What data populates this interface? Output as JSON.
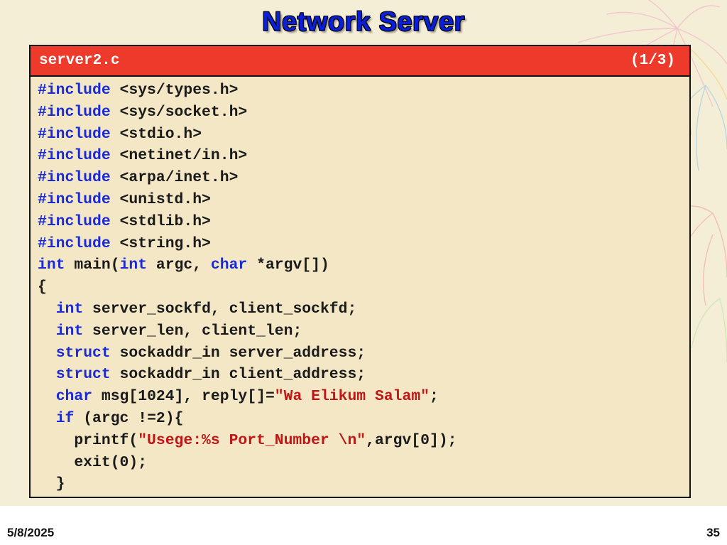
{
  "slide": {
    "title": "Network Server",
    "file_name": "server2.c",
    "page_indicator": "(1/3)",
    "footer_date": "5/8/2025",
    "footer_page": "35",
    "colors": {
      "title": "#0a1fd6",
      "header_bg": "#ee3a2a",
      "keyword": "#1a2ad6",
      "string": "#c01616",
      "background": "#f5eed6"
    }
  },
  "code_lines": [
    [
      {
        "t": "#include ",
        "c": "kw"
      },
      {
        "t": "<sys/types.h>",
        "c": ""
      }
    ],
    [
      {
        "t": "#include ",
        "c": "kw"
      },
      {
        "t": "<sys/socket.h>",
        "c": ""
      }
    ],
    [
      {
        "t": "#include ",
        "c": "kw"
      },
      {
        "t": "<stdio.h>",
        "c": ""
      }
    ],
    [
      {
        "t": "#include ",
        "c": "kw"
      },
      {
        "t": "<netinet/in.h>",
        "c": ""
      }
    ],
    [
      {
        "t": "#include ",
        "c": "kw"
      },
      {
        "t": "<arpa/inet.h>",
        "c": ""
      }
    ],
    [
      {
        "t": "#include ",
        "c": "kw"
      },
      {
        "t": "<unistd.h>",
        "c": ""
      }
    ],
    [
      {
        "t": "#include ",
        "c": "kw"
      },
      {
        "t": "<stdlib.h>",
        "c": ""
      }
    ],
    [
      {
        "t": "#include ",
        "c": "kw"
      },
      {
        "t": "<string.h>",
        "c": ""
      }
    ],
    [
      {
        "t": "int",
        "c": "kw"
      },
      {
        "t": " main(",
        "c": ""
      },
      {
        "t": "int",
        "c": "kw"
      },
      {
        "t": " argc, ",
        "c": ""
      },
      {
        "t": "char",
        "c": "kw"
      },
      {
        "t": " *argv[])",
        "c": ""
      }
    ],
    [
      {
        "t": "{",
        "c": ""
      }
    ],
    [
      {
        "t": "  ",
        "c": ""
      },
      {
        "t": "int",
        "c": "kw"
      },
      {
        "t": " server_sockfd, client_sockfd;",
        "c": ""
      }
    ],
    [
      {
        "t": "  ",
        "c": ""
      },
      {
        "t": "int",
        "c": "kw"
      },
      {
        "t": " server_len, client_len;",
        "c": ""
      }
    ],
    [
      {
        "t": "  ",
        "c": ""
      },
      {
        "t": "struct",
        "c": "kw"
      },
      {
        "t": " sockaddr_in server_address;",
        "c": ""
      }
    ],
    [
      {
        "t": "  ",
        "c": ""
      },
      {
        "t": "struct",
        "c": "kw"
      },
      {
        "t": " sockaddr_in client_address;",
        "c": ""
      }
    ],
    [
      {
        "t": "  ",
        "c": ""
      },
      {
        "t": "char",
        "c": "kw"
      },
      {
        "t": " msg[1024], reply[]=",
        "c": ""
      },
      {
        "t": "\"Wa Elikum Salam\"",
        "c": "str"
      },
      {
        "t": ";",
        "c": ""
      }
    ],
    [
      {
        "t": "  ",
        "c": ""
      },
      {
        "t": "if",
        "c": "kw"
      },
      {
        "t": " (argc !=2){",
        "c": ""
      }
    ],
    [
      {
        "t": "    printf(",
        "c": ""
      },
      {
        "t": "\"Usege:%s Port_Number \\n\"",
        "c": "str"
      },
      {
        "t": ",argv[0]);",
        "c": ""
      }
    ],
    [
      {
        "t": "    exit(0);",
        "c": ""
      }
    ],
    [
      {
        "t": "  }",
        "c": ""
      }
    ]
  ]
}
